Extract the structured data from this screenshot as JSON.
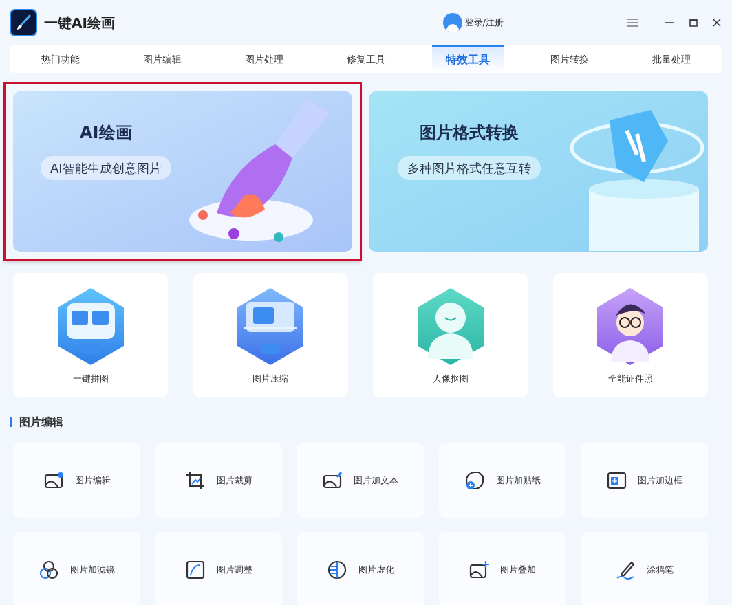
{
  "app": {
    "title": "一键AI绘画",
    "login": "登录/注册"
  },
  "tabs": [
    {
      "label": "热门功能",
      "selected": false
    },
    {
      "label": "图片编辑",
      "selected": false
    },
    {
      "label": "图片处理",
      "selected": false
    },
    {
      "label": "修复工具",
      "selected": false
    },
    {
      "label": "特效工具",
      "selected": true
    },
    {
      "label": "图片转换",
      "selected": false
    },
    {
      "label": "批量处理",
      "selected": false
    }
  ],
  "banners": [
    {
      "title": "AI绘画",
      "subtitle": "AI智能生成创意图片",
      "selected": true
    },
    {
      "title": "图片格式转换",
      "subtitle": "多种图片格式任意互转",
      "selected": false
    }
  ],
  "features": [
    {
      "label": "一键拼图"
    },
    {
      "label": "图片压缩"
    },
    {
      "label": "人像抠图"
    },
    {
      "label": "全能证件照"
    }
  ],
  "section": {
    "title": "图片编辑"
  },
  "tools": [
    {
      "label": "图片编辑"
    },
    {
      "label": "图片裁剪"
    },
    {
      "label": "图片加文本"
    },
    {
      "label": "图片加贴纸"
    },
    {
      "label": "图片加边框"
    },
    {
      "label": "图片加滤镜"
    },
    {
      "label": "图片调整"
    },
    {
      "label": "图片虚化"
    },
    {
      "label": "图片叠加"
    },
    {
      "label": "涂鸦笔"
    }
  ]
}
